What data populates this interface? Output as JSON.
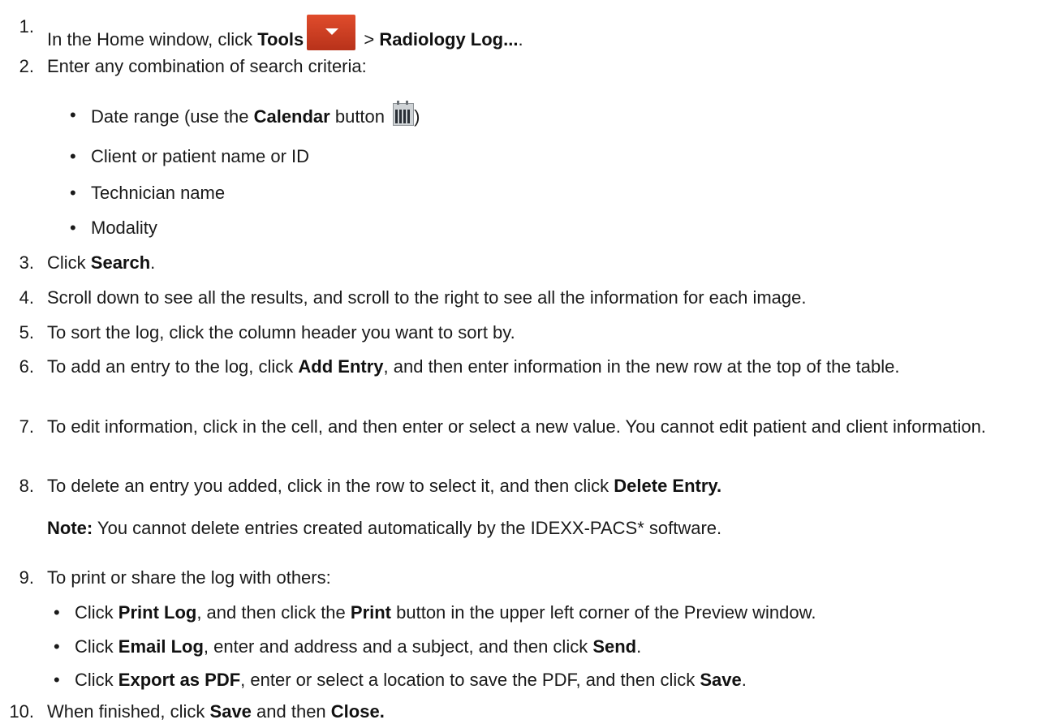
{
  "steps": {
    "s1": {
      "num": "1.",
      "pre": "In the Home window, click ",
      "b1": "Tools",
      "sep": " > ",
      "b2": "Radiology Log...",
      "post": "."
    },
    "s2": {
      "num": "2.",
      "text": "Enter any combination of search criteria:"
    },
    "s2_bullets": {
      "b0_pre": "Date range (use the ",
      "b0_bold": "Calendar",
      "b0_post": " button ",
      "b0_end": ")",
      "b1": "Client or patient name or ID",
      "b2": "Technician name",
      "b3": "Modality"
    },
    "s3": {
      "num": "3.",
      "pre": "Click ",
      "bold": "Search",
      "post": "."
    },
    "s4": {
      "num": "4.",
      "text": "Scroll down to see all the results, and scroll to the right to see all the information for each image."
    },
    "s5": {
      "num": "5.",
      "text": "To sort the log, click the column header you want to sort by."
    },
    "s6": {
      "num": "6.",
      "pre": "To add an entry to the log, click ",
      "bold": "Add Entry",
      "post": ", and then enter information in the new row at the top of the table."
    },
    "s7": {
      "num": "7.",
      "text": "To edit information, click in the cell, and then enter or select a new value. You cannot edit patient and client information."
    },
    "s8": {
      "num": "8.",
      "pre": "To delete an entry you added, click in the row to select it, and then click ",
      "bold": "Delete Entry."
    },
    "note": {
      "label": "Note:",
      "text": " You cannot delete entries created automatically by the IDEXX-PACS* software."
    },
    "s9": {
      "num": "9.",
      "text": "To print or share the log with others:"
    },
    "s9_bullets": {
      "b0_pre": "Click ",
      "b0_b1": "Print Log",
      "b0_mid": ", and then click the ",
      "b0_b2": "Print",
      "b0_post": " button in the upper left corner of the Preview window.",
      "b1_pre": "Click ",
      "b1_b1": "Email Log",
      "b1_mid": ", enter and address and a subject, and then click ",
      "b1_b2": "Send",
      "b1_post": ".",
      "b2_pre": "Click ",
      "b2_b1": "Export as PDF",
      "b2_mid": ", enter or select a location to save the PDF, and then click ",
      "b2_b2": "Save",
      "b2_post": "."
    },
    "s10": {
      "num": "10.",
      "pre": "When finished, click ",
      "b1": "Save",
      "mid": " and then ",
      "b2": "Close."
    }
  },
  "bullet_char": "•",
  "icons": [
    "tools-dropdown-icon",
    "calendar-icon"
  ],
  "colors": {
    "tools_icon": "#c73a1f",
    "text": "#1a1a1a"
  }
}
